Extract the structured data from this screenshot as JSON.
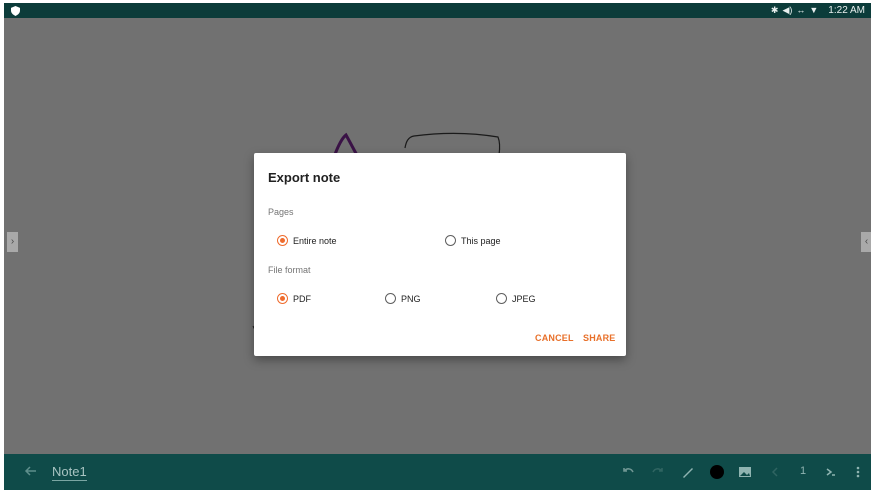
{
  "status_bar": {
    "time": "1:22 AM",
    "icons": [
      "shield-icon",
      "bluetooth-icon",
      "volume-icon",
      "data-sync-icon",
      "wifi-icon"
    ]
  },
  "note": {
    "title": "Note1"
  },
  "toolbar": {
    "icons": [
      "back-arrow-icon",
      "undo-icon",
      "redo-icon",
      "pen-icon",
      "color-dot-icon",
      "image-icon",
      "prev-page-icon",
      "next-page-icon",
      "more-icon"
    ],
    "page_number": "1",
    "pen_color": "#000000"
  },
  "dialog": {
    "title": "Export note",
    "pages_label": "Pages",
    "pages_options": [
      {
        "label": "Entire note",
        "selected": true
      },
      {
        "label": "This page",
        "selected": false
      }
    ],
    "format_label": "File format",
    "format_options": [
      {
        "label": "PDF",
        "selected": true
      },
      {
        "label": "PNG",
        "selected": false
      },
      {
        "label": "JPEG",
        "selected": false
      }
    ],
    "cancel_label": "CANCEL",
    "share_label": "SHARE"
  },
  "colors": {
    "accent": "#ef6c2e",
    "status_bar": "#0c3c3a",
    "bottom_bar": "#0f4b49",
    "scrim": "#717171"
  }
}
